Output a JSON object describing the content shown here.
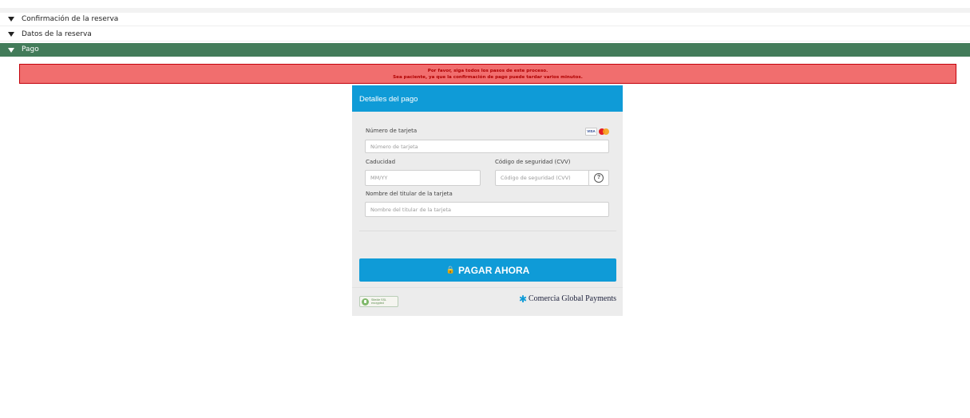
{
  "accordion": {
    "items": [
      {
        "label": "Confirmación de la reserva",
        "active": false
      },
      {
        "label": "Datos de la reserva",
        "active": false
      },
      {
        "label": "Pago",
        "active": true
      }
    ],
    "active_color": "#427b59"
  },
  "alert": {
    "line1": "Por favor, siga todos los pasos de este proceso.",
    "line2": "Sea paciente, ya que la confirmación de pago puede tardar varios minutos.",
    "background": "#f16e6e",
    "border": "#c2000b"
  },
  "payment": {
    "title": "Detalles del pago",
    "card_number": {
      "label": "Número de tarjeta",
      "placeholder": "Número de tarjeta",
      "value": ""
    },
    "expiry": {
      "label": "Caducidad",
      "placeholder": "MM/YY",
      "value": ""
    },
    "cvv": {
      "label": "Código de seguridad (CVV)",
      "placeholder": "Código de seguridad (CVV)",
      "value": "",
      "help_icon": "question-circle-icon",
      "help_text": "?"
    },
    "holder": {
      "label": "Nombre del titular de la tarjeta",
      "placeholder": "Nombre del titular de la tarjeta",
      "value": ""
    },
    "accepted_cards": {
      "visa": "VISA",
      "mastercard_icon": "mastercard-logo-icon"
    },
    "pay_button": {
      "label": "PAGAR AHORA",
      "icon": "lock-icon",
      "icon_glyph": "🔒"
    },
    "secure_badge": {
      "text": "Site/de SSL encrypted",
      "icon": "secure-lock-icon"
    },
    "provider": {
      "name": "Comercia Global Payments",
      "logo_icon": "star-logo-icon",
      "glyph": "✱"
    },
    "accent_color": "#0f9bd7"
  }
}
